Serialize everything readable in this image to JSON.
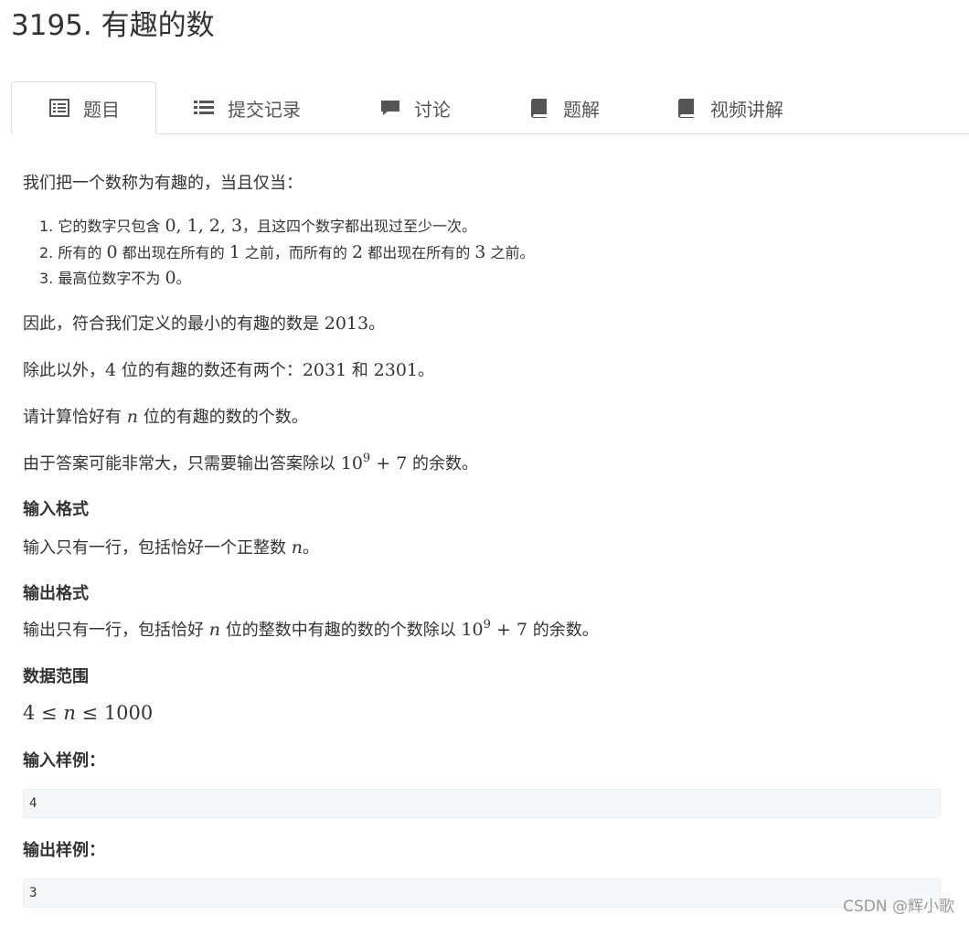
{
  "problem": {
    "title": "3195. 有趣的数"
  },
  "tabs": [
    {
      "label": "题目",
      "icon": "list-alt-icon",
      "active": true
    },
    {
      "label": "提交记录",
      "icon": "list-icon",
      "active": false
    },
    {
      "label": "讨论",
      "icon": "comment-icon",
      "active": false
    },
    {
      "label": "题解",
      "icon": "book-icon",
      "active": false
    },
    {
      "label": "视频讲解",
      "icon": "book-icon",
      "active": false
    }
  ],
  "statement": {
    "intro": "我们把一个数称为有趣的，当且仅当：",
    "rules": [
      {
        "num": "1.",
        "pre": "它的数字只包含 ",
        "math": "0, 1, 2, 3",
        "post": "，且这四个数字都出现过至少一次。"
      },
      {
        "num": "2.",
        "parts": [
          "所有的 ",
          "0",
          " 都出现在所有的 ",
          "1",
          " 之前，而所有的 ",
          "2",
          " 都出现在所有的 ",
          "3",
          " 之前。"
        ]
      },
      {
        "num": "3.",
        "pre": "最高位数字不为 ",
        "math": "0",
        "post": "。"
      }
    ],
    "smallest": {
      "pre": "因此，符合我们定义的最小的有趣的数是 ",
      "math": "2013",
      "post": "。"
    },
    "others": {
      "pre": "除此以外，",
      "math1": "4",
      "mid1": " 位的有趣的数还有两个：",
      "math2": "2031",
      "mid2": " 和 ",
      "math3": "2301",
      "post": "。"
    },
    "ask": {
      "pre": "请计算恰好有 ",
      "var": "n",
      "post": " 位的有趣的数的个数。"
    },
    "mod": {
      "pre": "由于答案可能非常大，只需要输出答案除以 ",
      "base": "10",
      "exp": "9",
      "plus": " + 7",
      "post": " 的余数。"
    }
  },
  "input_format": {
    "heading": "输入格式",
    "pre": "输入只有一行，包括恰好一个正整数 ",
    "var": "n",
    "post": "。"
  },
  "output_format": {
    "heading": "输出格式",
    "pre": "输出只有一行，包括恰好 ",
    "var": "n",
    "mid": " 位的整数中有趣的数的个数除以 ",
    "base": "10",
    "exp": "9",
    "plus": " + 7",
    "post": " 的余数。"
  },
  "data_range": {
    "heading": "数据范围",
    "lo": "4",
    "op1": " ≤ ",
    "var": "n",
    "op2": " ≤ ",
    "hi": "1000"
  },
  "sample_input": {
    "heading": "输入样例：",
    "value": "4"
  },
  "sample_output": {
    "heading": "输出样例：",
    "value": "3"
  },
  "watermark": "CSDN @辉小歌",
  "colors": {
    "text": "#333333",
    "tab_border": "#dddddd",
    "code_bg": "#f6f7f9",
    "icon": "#555555",
    "watermark": "#999999"
  }
}
